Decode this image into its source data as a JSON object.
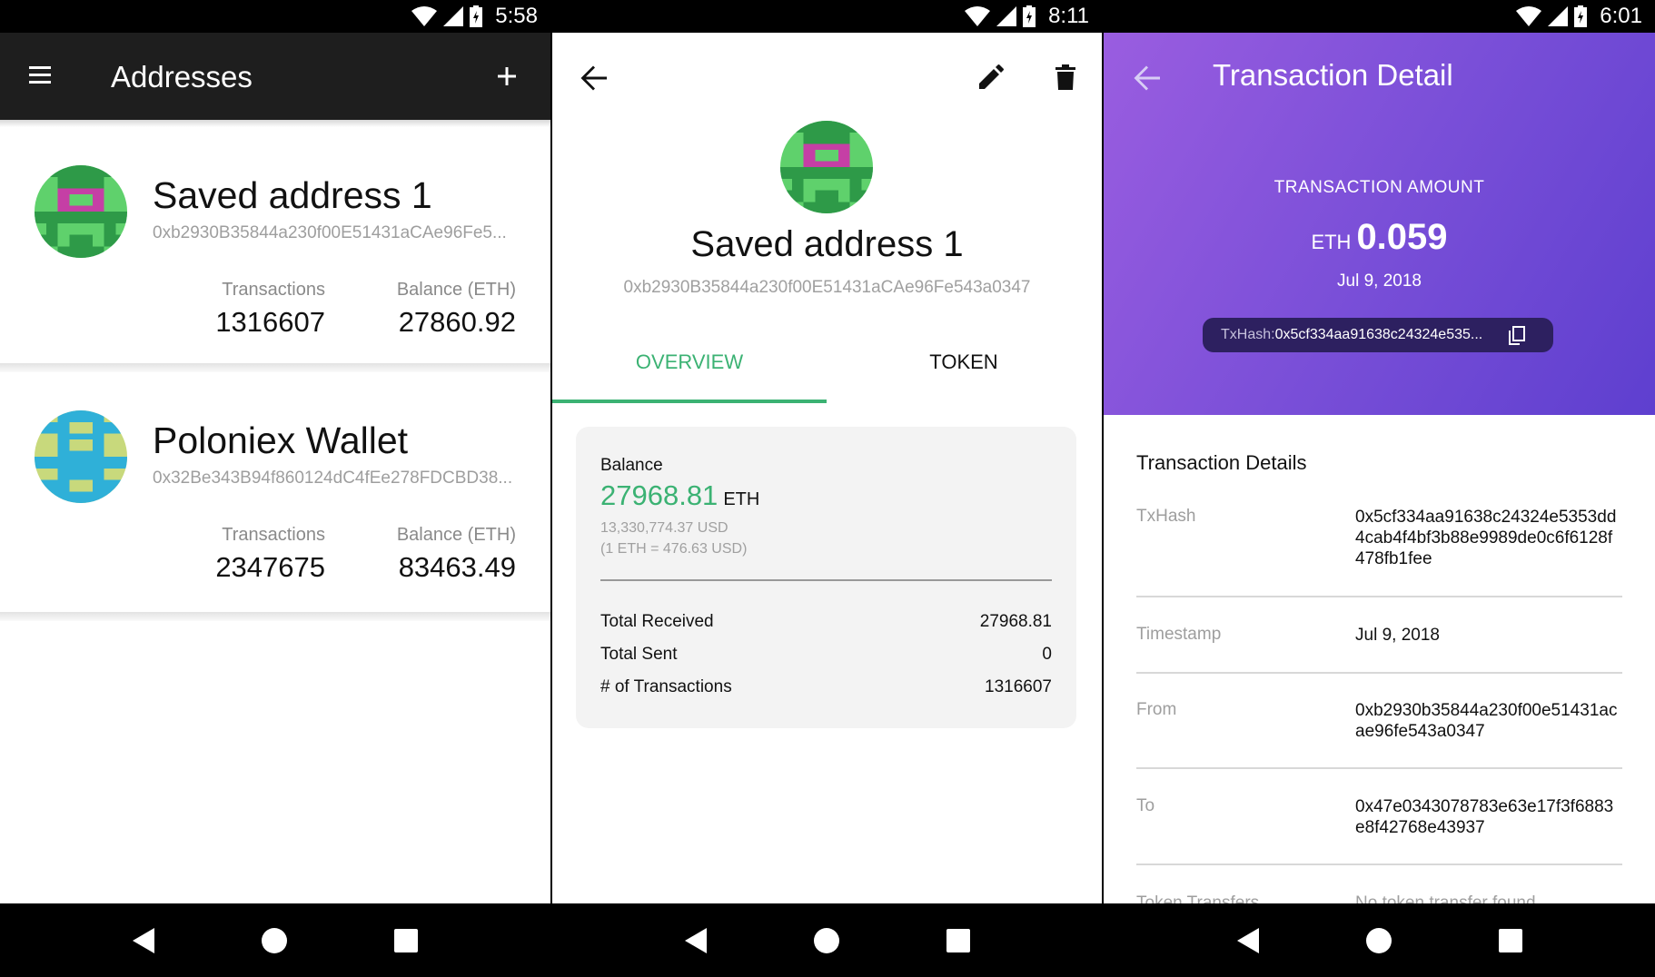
{
  "screen1": {
    "status_time": "5:58",
    "title": "Addresses",
    "icons": {
      "menu": "menu-icon",
      "add": "plus-icon"
    },
    "addresses": [
      {
        "name": "Saved address 1",
        "address": "0xb2930B35844a230f00E51431aCAe96Fe5...",
        "tx_label": "Transactions",
        "tx_value": "1316607",
        "bal_label": "Balance (ETH)",
        "bal_value": "27860.92"
      },
      {
        "name": "Poloniex Wallet",
        "address": "0x32Be343B94f860124dC4fEe278FDCBD38...",
        "tx_label": "Transactions",
        "tx_value": "2347675",
        "bal_label": "Balance (ETH)",
        "bal_value": "83463.49"
      }
    ]
  },
  "screen2": {
    "status_time": "8:11",
    "icons": {
      "back": "arrow-back-icon",
      "edit": "pencil-icon",
      "delete": "trash-icon"
    },
    "name": "Saved address 1",
    "address": "0xb2930B35844a230f00E51431aCAe96Fe543a0347",
    "tabs": [
      "OVERVIEW",
      "TOKEN"
    ],
    "balance_label": "Balance",
    "balance_value": "27968.81",
    "balance_unit": "ETH",
    "usd_value": "13,330,774.37 USD",
    "rate": "(1 ETH = 476.63 USD)",
    "rows": [
      {
        "label": "Total Received",
        "value": "27968.81"
      },
      {
        "label": "Total Sent",
        "value": "0"
      },
      {
        "label": "# of Transactions",
        "value": "1316607"
      }
    ],
    "accent": "#3bb273"
  },
  "screen3": {
    "status_time": "6:01",
    "title": "Transaction Detail",
    "amount_label": "TRANSACTION AMOUNT",
    "amount_currency": "ETH",
    "amount_value": "0.059",
    "date": "Jul 9, 2018",
    "pill_key": "TxHash:",
    "pill_value": "0x5cf334aa91638c24324e535...",
    "section_title": "Transaction Details",
    "rows": [
      {
        "label": "TxHash",
        "value": "0x5cf334aa91638c24324e5353dd4cab4f4bf3b88e9989de0c6f6128f478fb1fee"
      },
      {
        "label": "Timestamp",
        "value": "Jul 9, 2018"
      },
      {
        "label": "From",
        "value": "0xb2930b35844a230f00e51431acae96fe543a0347"
      },
      {
        "label": "To",
        "value": "0x47e0343078783e63e17f3f6883e8f42768e43937"
      }
    ],
    "cut_row": {
      "label": "Token Transfers",
      "value": "No token transfer found"
    },
    "header_colors": [
      "#9a5de0",
      "#5e3fcf"
    ]
  },
  "nav": {
    "back": "nav-back-icon",
    "home": "nav-home-icon",
    "recents": "nav-recents-icon"
  }
}
